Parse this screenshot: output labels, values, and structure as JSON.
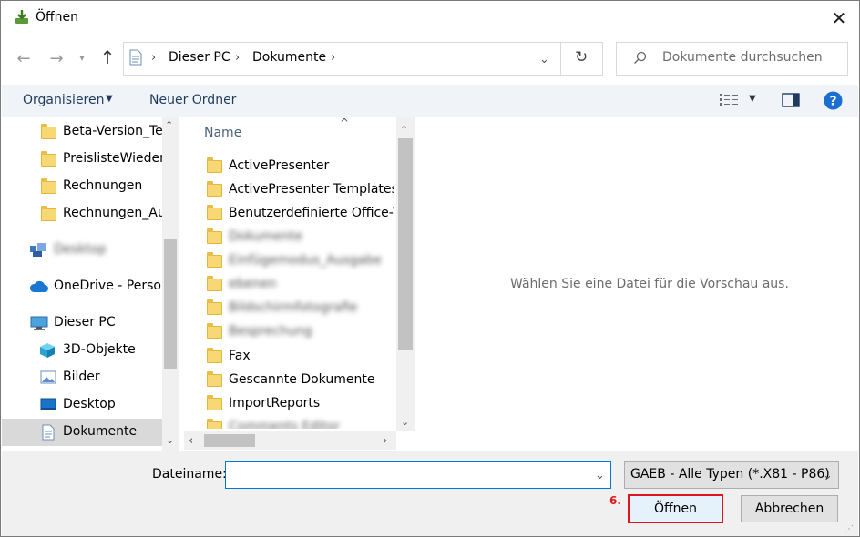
{
  "window": {
    "title": "Öffnen"
  },
  "address": {
    "crumbs": [
      "Dieser PC",
      "Dokumente"
    ]
  },
  "search": {
    "placeholder": "Dokumente durchsuchen"
  },
  "toolbar": {
    "organize": "Organisieren",
    "new_folder": "Neuer Ordner"
  },
  "nav": {
    "folders": [
      "Beta-Version_Tes",
      "PreislisteWiederh",
      "Rechnungen",
      "Rechnungen_Au"
    ],
    "blurred": "Desktop",
    "onedrive": "OneDrive - Persor",
    "this_pc": "Dieser PC",
    "pc_items": [
      "3D-Objekte",
      "Bilder",
      "Desktop",
      "Dokumente"
    ]
  },
  "filelist": {
    "column_name": "Name",
    "items": [
      {
        "label": "ActivePresenter",
        "blurred": false
      },
      {
        "label": "ActivePresenter Templates",
        "blurred": false
      },
      {
        "label": "Benutzerdefinierte Office-Vo",
        "blurred": false
      },
      {
        "label": "Dokumente",
        "blurred": true
      },
      {
        "label": "Einfügemodus_Ausgabe",
        "blurred": true
      },
      {
        "label": "ebenen",
        "blurred": true
      },
      {
        "label": "Bildschirmfotografie",
        "blurred": true
      },
      {
        "label": "Besprechung",
        "blurred": true
      },
      {
        "label": "Fax",
        "blurred": false
      },
      {
        "label": "Gescannte Dokumente",
        "blurred": false
      },
      {
        "label": "ImportReports",
        "blurred": false
      },
      {
        "label": "Comments Editor",
        "blurred": true
      }
    ]
  },
  "preview": {
    "text": "Wählen Sie eine Datei für die Vorschau aus."
  },
  "footer": {
    "filename_label": "Dateiname:",
    "filename_value": "",
    "filter_value": "GAEB - Alle Typen (*.X81 - P86)",
    "open_label": "Öffnen",
    "cancel_label": "Abbrechen",
    "step_label": "6."
  },
  "colors": {
    "accent": "#0078d7",
    "highlight": "#e0141e",
    "help": "#1a6fd1"
  }
}
